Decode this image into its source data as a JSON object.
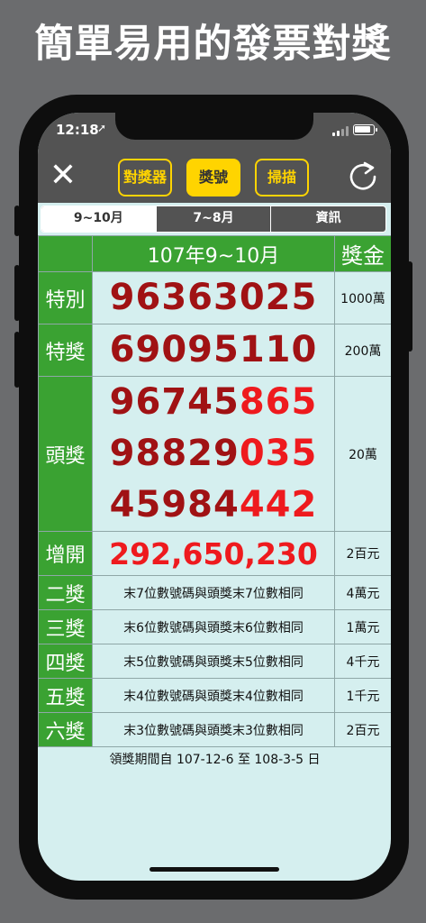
{
  "headline": "簡單易用的發票對獎",
  "status": {
    "time": "12:18",
    "location_icon": "location-arrow-icon"
  },
  "toolbar": {
    "close_icon": "close-icon",
    "buttons": [
      {
        "label": "對獎器",
        "active": false
      },
      {
        "label": "獎號",
        "active": true
      },
      {
        "label": "掃描",
        "active": false
      }
    ],
    "refresh_icon": "refresh-icon"
  },
  "tabs": [
    "9~10月",
    "7~8月",
    "資訊"
  ],
  "table": {
    "header_period": "107年9~10月",
    "header_amount": "獎金",
    "special": {
      "label": "特別",
      "number": "96363025",
      "amount": "1000萬"
    },
    "grand": {
      "label": "特獎",
      "number": "69095110",
      "amount": "200萬"
    },
    "first": {
      "label": "頭獎",
      "numbers": [
        {
          "head": "96745",
          "tail": "865"
        },
        {
          "head": "98829",
          "tail": "035"
        },
        {
          "head": "45984",
          "tail": "442"
        }
      ],
      "amount": "20萬"
    },
    "extra": {
      "label": "增開",
      "numbers": "292,650,230",
      "amount": "2百元"
    },
    "prizes": [
      {
        "label": "二獎",
        "rule": "末7位數號碼與頭獎末7位數相同",
        "amount": "4萬元"
      },
      {
        "label": "三獎",
        "rule": "末6位數號碼與頭獎末6位數相同",
        "amount": "1萬元"
      },
      {
        "label": "四獎",
        "rule": "末5位數號碼與頭獎末5位數相同",
        "amount": "4千元"
      },
      {
        "label": "五獎",
        "rule": "末4位數號碼與頭獎末4位數相同",
        "amount": "1千元"
      },
      {
        "label": "六獎",
        "rule": "末3位數號碼與頭獎末3位數相同",
        "amount": "2百元"
      }
    ]
  },
  "claim_period": "領獎期間自 107-12-6 至 108-3-5 日",
  "colors": {
    "green": "#3aa232",
    "dark_red": "#a01214",
    "bright_red": "#ee1a1e",
    "yellow": "#ffd400",
    "toolbar_gray": "#535353",
    "table_bg": "#d5efef"
  }
}
